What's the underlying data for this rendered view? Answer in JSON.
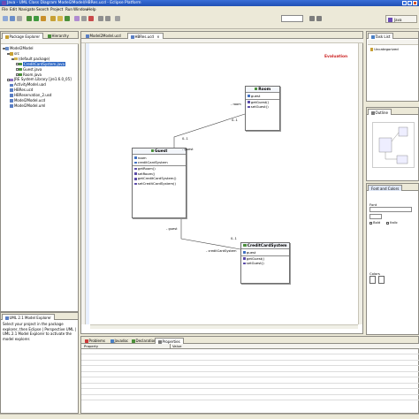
{
  "window": {
    "title": "Java - UML Class Diagram Model2Model/HBRes.ucd - Eclipse Platform",
    "controls": [
      "minimize",
      "maximize",
      "close"
    ]
  },
  "menu": {
    "items": [
      "File",
      "Edit",
      "Navigate",
      "Search",
      "Project",
      "Run",
      "Window",
      "Help"
    ]
  },
  "perspective": {
    "label": "Java"
  },
  "package_explorer": {
    "tabs": [
      "Package Explorer",
      "Hierarchy"
    ],
    "tree": [
      {
        "label": "Model2Model",
        "level": 0,
        "icon": "project-icon",
        "expander": "expanded"
      },
      {
        "label": "src",
        "level": 1,
        "icon": "source-folder-icon",
        "expander": "expanded"
      },
      {
        "label": "(default package)",
        "level": 2,
        "icon": "package-icon",
        "expander": "expanded"
      },
      {
        "label": "CreditCardSystem.java",
        "level": 3,
        "icon": "java-file-icon",
        "expander": "collapsed",
        "selected": true
      },
      {
        "label": "Guest.java",
        "level": 3,
        "icon": "java-file-icon",
        "expander": "collapsed"
      },
      {
        "label": "Room.java",
        "level": 3,
        "icon": "java-file-icon",
        "expander": "collapsed"
      },
      {
        "label": "JRE System Library [jre1.6.0_05]",
        "level": 1,
        "icon": "library-icon",
        "expander": "collapsed"
      },
      {
        "label": "ActivityModel.uad",
        "level": 1,
        "icon": "uml-file-icon",
        "expander": "none"
      },
      {
        "label": "HBRes.ucd",
        "level": 1,
        "icon": "uml-file-icon",
        "expander": "none"
      },
      {
        "label": "HBReservation_2.usd",
        "level": 1,
        "icon": "uml-file-icon",
        "expander": "none"
      },
      {
        "label": "Model2Model.ucd",
        "level": 1,
        "icon": "uml-file-icon",
        "expander": "none"
      },
      {
        "label": "Model2Model.uml",
        "level": 1,
        "icon": "uml-file-icon",
        "expander": "none"
      }
    ]
  },
  "uml_explorer": {
    "tab": "UML 2.1 Model Explorer",
    "message": "Select your project in the package explorer, then Eclipse | Perspective UML | UML 2.1 Model Explorer to activate the model explorer."
  },
  "editor": {
    "tabs": [
      "Model2Model.ucd",
      "HBRes.ucd"
    ],
    "active_tab": "HBRes.ucd",
    "badge": "Evaluation",
    "classes": {
      "room": {
        "name": "Room",
        "fields": [
          "guest"
        ],
        "methods": [
          "getGuest()",
          "setGuest()"
        ]
      },
      "guest": {
        "name": "Guest",
        "fields": [
          "room",
          "creditCardSystem"
        ],
        "methods": [
          "getRoom()",
          "setRoom()",
          "getCreditCardSystem()",
          "setCreditCardSystem()"
        ]
      },
      "credit": {
        "name": "CreditCardSystem",
        "fields": [
          "guest"
        ],
        "methods": [
          "getGuest()",
          "setGuest()"
        ]
      }
    },
    "associations": {
      "room_guest": {
        "role_room": "- room",
        "role_guest": "- guest",
        "mult_room": "0..1",
        "mult_guest": "0..1"
      },
      "guest_credit": {
        "role_guest": "- guest",
        "role_credit": "- creditCardSystem",
        "mult_credit": "0..1"
      }
    }
  },
  "task_list": {
    "tab": "Task List",
    "category": "Uncategorized"
  },
  "outline": {
    "tab": "Outline"
  },
  "fonts_colors": {
    "tab": "Font and Colors",
    "font_label": "Font",
    "bold_label": "Bold",
    "italic_label": "Italic",
    "colors_label": "Colors"
  },
  "bottom": {
    "tabs": [
      "Problems",
      "Javadoc",
      "Declaration",
      "Properties"
    ],
    "active_tab": "Properties",
    "columns": [
      "Property",
      "Value"
    ]
  },
  "colors": {
    "title_bar": "#1f4fb4",
    "chrome": "#ece9d8",
    "selection": "#316ac5",
    "badge": "#cc2222"
  }
}
